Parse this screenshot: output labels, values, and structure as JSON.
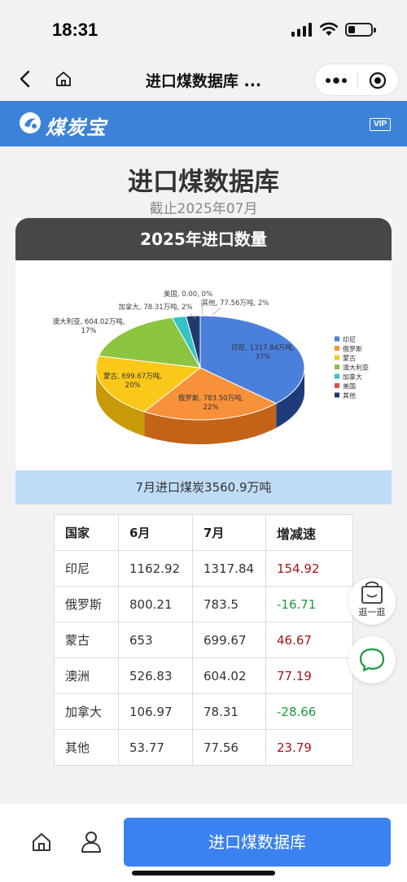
{
  "status": {
    "time": "18:31"
  },
  "nav": {
    "title": "进口煤数据库 ..."
  },
  "brand": {
    "name": "煤炭宝",
    "vip": "VIP"
  },
  "page": {
    "title": "进口煤数据库",
    "date": "截止2025年07月"
  },
  "card": {
    "header": "2025年进口数量",
    "summary": "7月进口煤炭3560.9万吨"
  },
  "chart_data": {
    "type": "pie",
    "title": "2025年进口数量",
    "watermark": "煤炭宝",
    "legend_position": "right",
    "slices": [
      {
        "name": "印尼",
        "value": 1317.84,
        "percent": 37,
        "label": "印尼, 1317.84万吨,",
        "percent_label": "37%",
        "color": "#4a7fdc",
        "dark": "#1f3a7a"
      },
      {
        "name": "俄罗斯",
        "value": 783.5,
        "percent": 22,
        "label": "俄罗斯, 783.50万吨,",
        "percent_label": "22%",
        "color": "#f7923a",
        "dark": "#c26318"
      },
      {
        "name": "蒙古",
        "value": 699.67,
        "percent": 20,
        "label": "蒙古, 699.67万吨,",
        "percent_label": "20%",
        "color": "#f9c818",
        "dark": "#c99a08"
      },
      {
        "name": "澳大利亚",
        "value": 604.02,
        "percent": 17,
        "label": "澳大利亚, 604.02万吨,",
        "percent_label": "17%",
        "color": "#8bc53f",
        "dark": "#5d8a22"
      },
      {
        "name": "加拿大",
        "value": 78.31,
        "percent": 2,
        "label": "加拿大, 78.31万吨, 2%",
        "percent_label": "",
        "color": "#35c3c6",
        "dark": "#1f8a8c"
      },
      {
        "name": "美国",
        "value": 0.0,
        "percent": 0,
        "label": "美国, 0.00, 0%",
        "percent_label": "",
        "color": "#e0504a",
        "dark": "#a02a26"
      },
      {
        "name": "其他",
        "value": 77.56,
        "percent": 2,
        "label": "其他, 77.56万吨, 2%",
        "percent_label": "",
        "color": "#1f3a6e",
        "dark": "#11234a"
      }
    ]
  },
  "table": {
    "headers": [
      "国家",
      "6月",
      "7月",
      "增减速"
    ],
    "rows": [
      [
        "印尼",
        "1162.92",
        "1317.84",
        "154.92"
      ],
      [
        "俄罗斯",
        "800.21",
        "783.5",
        "-16.71"
      ],
      [
        "蒙古",
        "653",
        "699.67",
        "46.67"
      ],
      [
        "澳洲",
        "526.83",
        "604.02",
        "77.19"
      ],
      [
        "加拿大",
        "106.97",
        "78.31",
        "-28.66"
      ],
      [
        "其他",
        "53.77",
        "77.56",
        "23.79"
      ]
    ]
  },
  "float": {
    "shop_label": "逛一逛"
  },
  "bottom": {
    "main_button": "进口煤数据库"
  }
}
